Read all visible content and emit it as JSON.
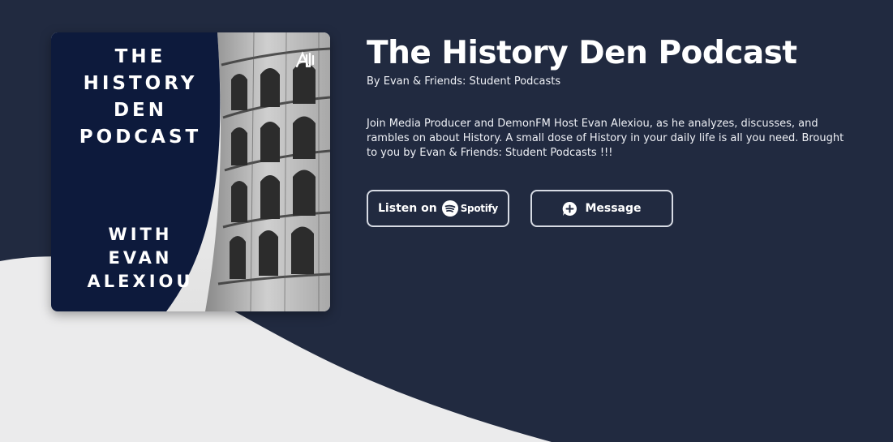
{
  "colors": {
    "page_background": "#212A40",
    "wave_fill": "#EBEBEC",
    "cover_panel": "#0D1A3C",
    "text": "#FFFFFF",
    "button_border": "#D7DBE4"
  },
  "cover": {
    "title_lines": [
      "THE",
      "HISTORY",
      "DEN",
      "PODCAST"
    ],
    "subtitle_lines": [
      "WITH",
      "EVAN",
      "ALEXIOU"
    ],
    "logo_icon": "anchor-logo-icon",
    "photo": "colosseum-photo"
  },
  "podcast": {
    "title": "The History Den Podcast",
    "author": "By Evan & Friends: Student Podcasts",
    "description": "Join Media Producer and DemonFM Host Evan Alexiou, as he analyzes, discusses, and rambles on about History. A small dose of History in your daily life is all you need. Brought to you by Evan & Friends: Student Podcasts !!!"
  },
  "actions": {
    "listen_label": "Listen on",
    "spotify_label": "Spotify",
    "spotify_icon": "spotify-icon",
    "message_label": "Message",
    "message_icon": "message-plus-icon"
  }
}
